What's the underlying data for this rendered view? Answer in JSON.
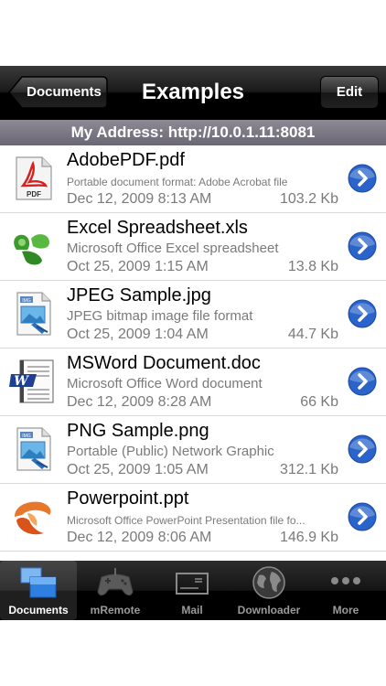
{
  "navbar": {
    "back_label": "Documents",
    "title": "Examples",
    "edit_label": "Edit"
  },
  "address": {
    "text": "My Address: http://10.0.1.11:8081"
  },
  "files": [
    {
      "name": "AdobePDF.pdf",
      "description": "Portable document format: Adobe Acrobat file",
      "date": "Dec 12, 2009 8:13 AM",
      "size": "103.2 Kb",
      "icon": "pdf-file-icon"
    },
    {
      "name": "Excel Spreadsheet.xls",
      "description": "Microsoft Office Excel spreadsheet",
      "date": "Oct 25, 2009 1:15 AM",
      "size": "13.8 Kb",
      "icon": "excel-file-icon"
    },
    {
      "name": "JPEG Sample.jpg",
      "description": "JPEG bitmap image file format",
      "date": "Oct 25, 2009 1:04 AM",
      "size": "44.7 Kb",
      "icon": "image-file-icon"
    },
    {
      "name": "MSWord Document.doc",
      "description": "Microsoft Office Word document",
      "date": "Dec 12, 2009 8:28 AM",
      "size": "66 Kb",
      "icon": "word-file-icon"
    },
    {
      "name": "PNG Sample.png",
      "description": "Portable (Public) Network Graphic",
      "date": "Oct 25, 2009 1:05 AM",
      "size": "312.1 Kb",
      "icon": "image-file-icon"
    },
    {
      "name": "Powerpoint.ppt",
      "description": "Microsoft Office PowerPoint Presentation file fo...",
      "date": "Dec 12, 2009 8:06 AM",
      "size": "146.9 Kb",
      "icon": "powerpoint-file-icon"
    }
  ],
  "tabs": [
    {
      "label": "Documents",
      "icon": "documents-icon",
      "active": true
    },
    {
      "label": "mRemote",
      "icon": "gamepad-icon",
      "active": false
    },
    {
      "label": "Mail",
      "icon": "mail-icon",
      "active": false
    },
    {
      "label": "Downloader",
      "icon": "globe-icon",
      "active": false
    },
    {
      "label": "More",
      "icon": "more-icon",
      "active": false
    }
  ],
  "colors": {
    "accent": "#2a63c9",
    "address_bar": "#7a7784",
    "navbar": "#000000"
  }
}
